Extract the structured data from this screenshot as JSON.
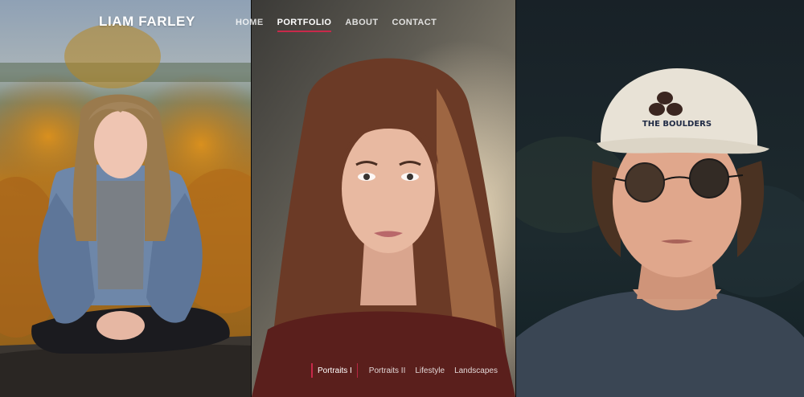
{
  "brand": {
    "name": "LIAM FARLEY"
  },
  "nav": {
    "items": [
      {
        "label": "HOME"
      },
      {
        "label": "PORTFOLIO",
        "active": true
      },
      {
        "label": "ABOUT"
      },
      {
        "label": "CONTACT"
      }
    ]
  },
  "portfolio_nav": {
    "items": [
      {
        "label": "Portraits I",
        "active": true
      },
      {
        "label": "Portraits II"
      },
      {
        "label": "Lifestyle"
      },
      {
        "label": "Landscapes"
      }
    ]
  },
  "photos": {
    "left": {
      "cap_text": ""
    },
    "right": {
      "cap_text": "THE BOULDERS"
    }
  },
  "colors": {
    "accent": "#c8294a",
    "nav_text": "#ffffff"
  }
}
